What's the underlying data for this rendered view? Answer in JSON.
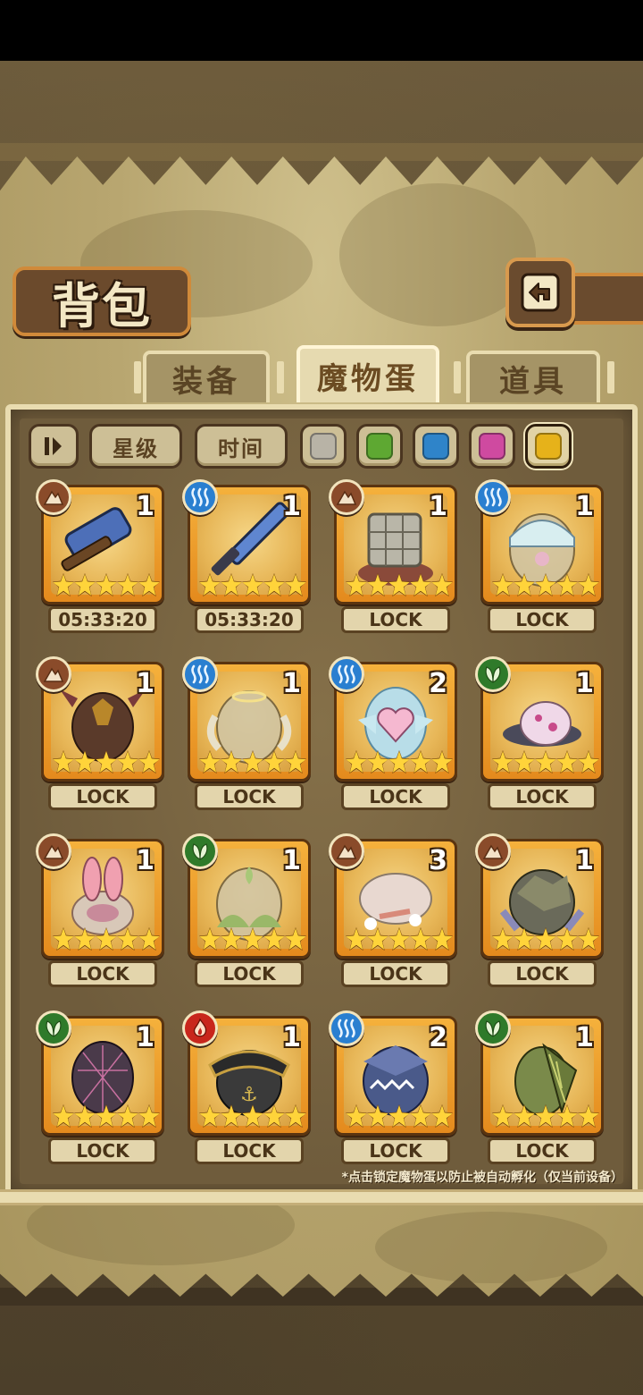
{
  "title": "背包",
  "tabs": [
    {
      "label": "装备",
      "active": false
    },
    {
      "label": "魔物蛋",
      "active": true
    },
    {
      "label": "道具",
      "active": false
    }
  ],
  "filters": {
    "sort_toggle_icon": "sort-toggle-icon",
    "star_label": "星级",
    "time_label": "时间",
    "color_swatches": [
      {
        "name": "gray",
        "color": "#b8b3a6",
        "selected": false
      },
      {
        "name": "green",
        "color": "#5ea832",
        "selected": false
      },
      {
        "name": "blue",
        "color": "#2f84c9",
        "selected": false
      },
      {
        "name": "pink",
        "color": "#cf4aa0",
        "selected": false
      },
      {
        "name": "gold",
        "color": "#e6b21a",
        "selected": true
      }
    ]
  },
  "colors": {
    "earth": "#8a4b2a",
    "water": "#2a7fd0",
    "wood": "#2f7a2a",
    "fire": "#c8261c"
  },
  "eggs": [
    {
      "element": "earth",
      "count": "1",
      "stars": 5,
      "tag": "05:33:20",
      "icon": "hammer-icon"
    },
    {
      "element": "water",
      "count": "1",
      "stars": 5,
      "tag": "05:33:20",
      "icon": "sword-icon"
    },
    {
      "element": "earth",
      "count": "1",
      "stars": 5,
      "tag": "LOCK",
      "icon": "cube-egg-icon"
    },
    {
      "element": "water",
      "count": "1",
      "stars": 5,
      "tag": "LOCK",
      "icon": "bonnet-egg-icon"
    },
    {
      "element": "earth",
      "count": "1",
      "stars": 5,
      "tag": "LOCK",
      "icon": "horned-egg-icon"
    },
    {
      "element": "water",
      "count": "1",
      "stars": 5,
      "tag": "LOCK",
      "icon": "angel-egg-icon"
    },
    {
      "element": "water",
      "count": "2",
      "stars": 5,
      "tag": "LOCK",
      "icon": "heart-egg-icon"
    },
    {
      "element": "wood",
      "count": "1",
      "stars": 5,
      "tag": "LOCK",
      "icon": "spotted-egg-icon"
    },
    {
      "element": "earth",
      "count": "1",
      "stars": 5,
      "tag": "LOCK",
      "icon": "bunny-egg-icon"
    },
    {
      "element": "wood",
      "count": "1",
      "stars": 5,
      "tag": "LOCK",
      "icon": "leaf-egg-icon"
    },
    {
      "element": "earth",
      "count": "3",
      "stars": 5,
      "tag": "LOCK",
      "icon": "flower-egg-icon"
    },
    {
      "element": "earth",
      "count": "1",
      "stars": 5,
      "tag": "LOCK",
      "icon": "rock-egg-icon"
    },
    {
      "element": "wood",
      "count": "1",
      "stars": 5,
      "tag": "LOCK",
      "icon": "web-egg-icon"
    },
    {
      "element": "fire",
      "count": "1",
      "stars": 5,
      "tag": "LOCK",
      "icon": "pirate-egg-icon"
    },
    {
      "element": "water",
      "count": "2",
      "stars": 5,
      "tag": "LOCK",
      "icon": "shark-egg-icon"
    },
    {
      "element": "wood",
      "count": "1",
      "stars": 5,
      "tag": "LOCK",
      "icon": "wing-egg-icon"
    }
  ],
  "footnote": "*点击锁定魔物蛋以防止被自动孵化（仅当前设备）"
}
